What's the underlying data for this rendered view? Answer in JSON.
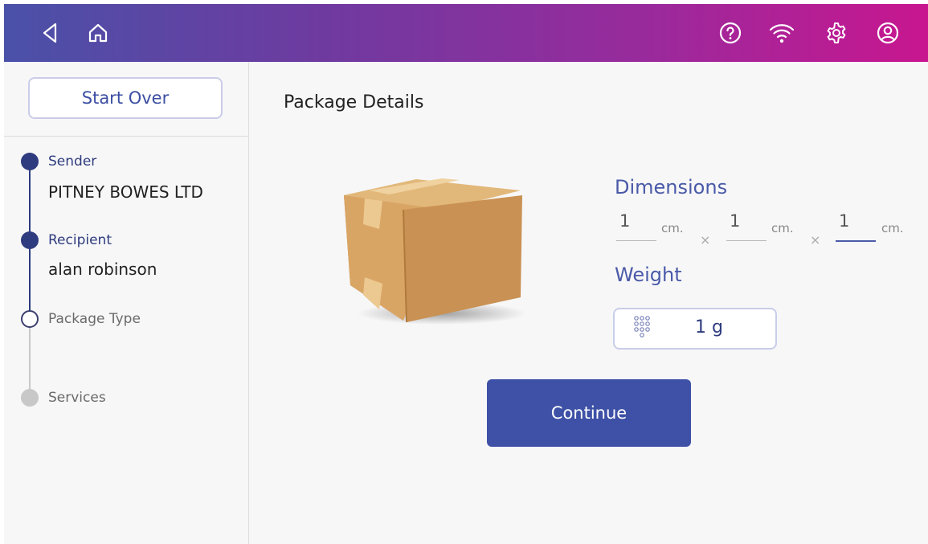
{
  "topbar": {
    "icons": [
      "back-icon",
      "home-icon",
      "help-icon",
      "wifi-icon",
      "settings-icon",
      "account-icon"
    ]
  },
  "sidebar": {
    "start_over_label": "Start Over",
    "steps": [
      {
        "label": "Sender",
        "value": "PITNEY BOWES LTD",
        "state": "done"
      },
      {
        "label": "Recipient",
        "value": "alan robinson",
        "state": "done"
      },
      {
        "label": "Package Type",
        "value": "",
        "state": "current"
      },
      {
        "label": "Services",
        "value": "",
        "state": "todo"
      }
    ]
  },
  "main": {
    "title": "Package Details",
    "dimensions_label": "Dimensions",
    "dimensions": [
      {
        "value": "1",
        "unit": "cm."
      },
      {
        "value": "1",
        "unit": "cm."
      },
      {
        "value": "1",
        "unit": "cm."
      }
    ],
    "times_symbol": "×",
    "weight_label": "Weight",
    "weight_value": "1 g",
    "continue_label": "Continue"
  },
  "colors": {
    "accent": "#3e51a6",
    "step_active": "#2e3b7e",
    "gradient_start": "#4a51a8",
    "gradient_end": "#c8168f"
  }
}
